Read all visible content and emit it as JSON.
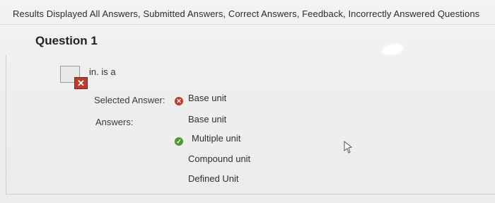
{
  "header": {
    "results_text": "Results Displayed All Answers, Submitted Answers, Correct Answers, Feedback, Incorrectly Answered Questions"
  },
  "question": {
    "title": "Question 1",
    "text": "in. is a",
    "status_icon": "incorrect-x-icon",
    "selected_answer_label": "Selected Answer:",
    "answers_label": "Answers:",
    "selected_answer": "Base unit",
    "answers": [
      "Base unit",
      "Multiple unit",
      "Compound unit",
      "Defined Unit"
    ],
    "correct_answer_index": 1
  },
  "colors": {
    "incorrect": "#c0392b",
    "correct": "#4e9a2e"
  }
}
